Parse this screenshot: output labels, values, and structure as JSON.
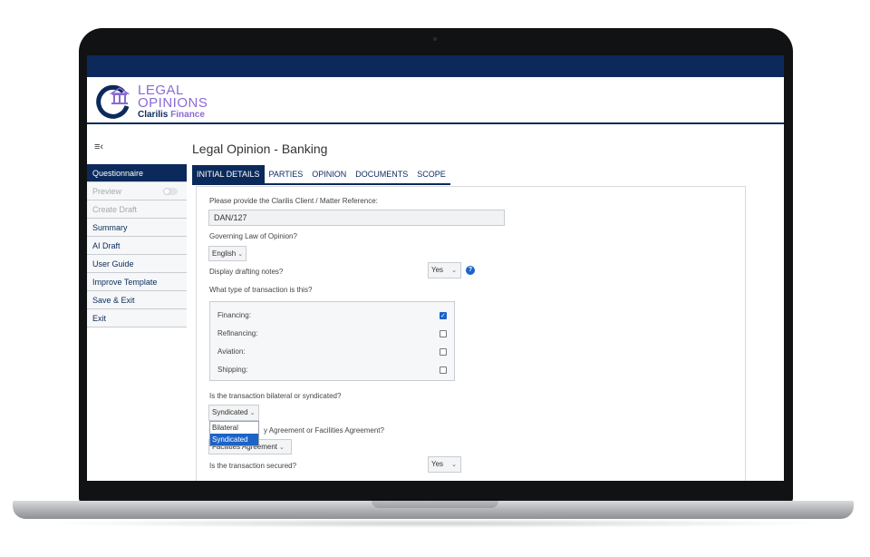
{
  "logo": {
    "line1": "LEGAL",
    "line2": "OPINIONS",
    "brand": "Clarilis",
    "brand_accent": "Finance"
  },
  "menu_toggle_icon": "≡‹",
  "sidebar": {
    "items": [
      {
        "label": "Questionnaire",
        "state": "active"
      },
      {
        "label": "Preview",
        "state": "disabled",
        "toggle": false
      },
      {
        "label": "Create Draft",
        "state": "disabled"
      },
      {
        "label": "Summary",
        "state": "normal"
      },
      {
        "label": "AI Draft",
        "state": "normal"
      },
      {
        "label": "User Guide",
        "state": "normal"
      },
      {
        "label": "Improve Template",
        "state": "normal"
      },
      {
        "label": "Save & Exit",
        "state": "normal"
      },
      {
        "label": "Exit",
        "state": "normal"
      }
    ]
  },
  "page": {
    "title": "Legal Opinion - Banking",
    "tabs": [
      "INITIAL DETAILS",
      "PARTIES",
      "OPINION",
      "DOCUMENTS",
      "SCOPE"
    ],
    "active_tab": 0
  },
  "form": {
    "reference_label": "Please provide the Clarilis Client / Matter Reference:",
    "reference_value": "DAN/127",
    "governing_law_label": "Governing Law of Opinion?",
    "governing_law_value": "English",
    "drafting_notes_label": "Display drafting notes?",
    "drafting_notes_value": "Yes",
    "transaction_type_label": "What type of transaction is this?",
    "transaction_types": [
      {
        "label": "Financing:",
        "checked": true
      },
      {
        "label": "Refinancing:",
        "checked": false
      },
      {
        "label": "Aviation:",
        "checked": false
      },
      {
        "label": "Shipping:",
        "checked": false
      }
    ],
    "bilateral_label": "Is the transaction bilateral or syndicated?",
    "bilateral_value": "Syndicated",
    "bilateral_options": [
      "Bilateral",
      "Syndicated"
    ],
    "agreement_label_partial": "y Agreement or Facilities Agreement?",
    "agreement_value": "Facilities Agreement",
    "secured_label": "Is the transaction secured?",
    "secured_value": "Yes"
  },
  "colors": {
    "navy": "#0b2a5b",
    "logo_purple": "#8a6ad6",
    "accent_blue": "#1c63c7"
  }
}
